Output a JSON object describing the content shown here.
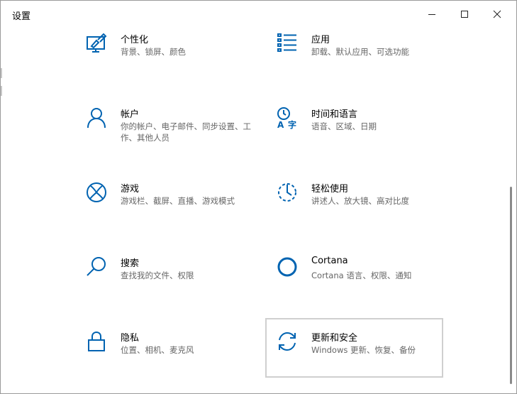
{
  "window": {
    "title": "设置",
    "accent": "#0063b1"
  },
  "tiles": [
    {
      "label": "个性化",
      "desc": "背景、锁屏、颜色",
      "icon": "personalization-icon"
    },
    {
      "label": "应用",
      "desc": "卸载、默认应用、可选功能",
      "icon": "apps-icon"
    },
    {
      "label": "帐户",
      "desc": "你的帐户、电子邮件、同步设置、工作、其他人员",
      "icon": "accounts-icon"
    },
    {
      "label": "时间和语言",
      "desc": "语音、区域、日期",
      "icon": "time-language-icon"
    },
    {
      "label": "游戏",
      "desc": "游戏栏、截屏、直播、游戏模式",
      "icon": "gaming-icon"
    },
    {
      "label": "轻松使用",
      "desc": "讲述人、放大镜、高对比度",
      "icon": "ease-of-access-icon"
    },
    {
      "label": "搜索",
      "desc": "查找我的文件、权限",
      "icon": "search-icon"
    },
    {
      "label": "Cortana",
      "desc": "Cortana 语言、权限、通知",
      "icon": "cortana-icon"
    },
    {
      "label": "隐私",
      "desc": "位置、相机、麦克风",
      "icon": "privacy-lock-icon"
    },
    {
      "label": "更新和安全",
      "desc": "Windows 更新、恢复、备份",
      "icon": "update-security-icon"
    }
  ]
}
